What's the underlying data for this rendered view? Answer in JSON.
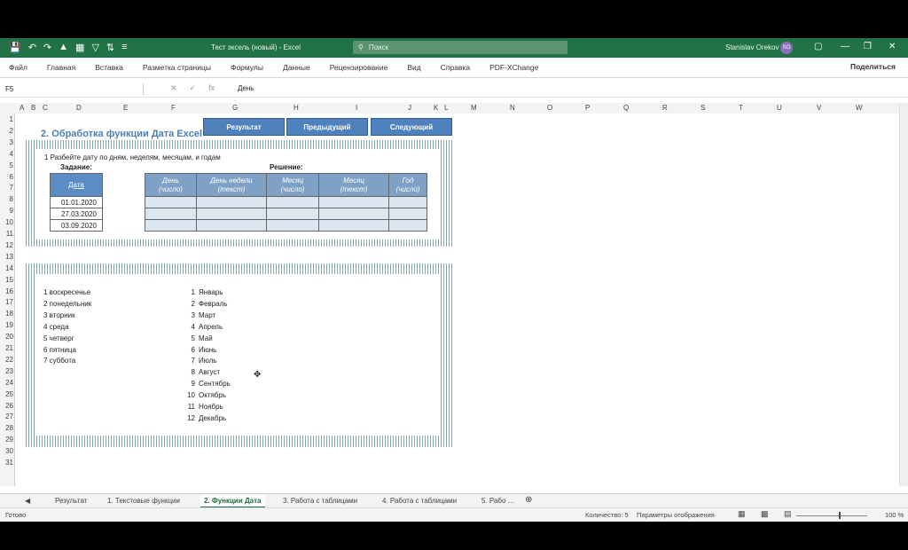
{
  "app": {
    "title": "Тест эксель (новый)  -  Excel",
    "search_placeholder": "Поиск",
    "user_name": "Stanislav Orekov",
    "user_initials": "SO"
  },
  "ribbon": {
    "tabs": [
      "Файл",
      "Главная",
      "Вставка",
      "Разметка страницы",
      "Формулы",
      "Данные",
      "Рецензирование",
      "Вид",
      "Справка",
      "PDF-XChange"
    ],
    "share_label": "Поделиться"
  },
  "formula_bar": {
    "name_box": "F5",
    "fx": "fx",
    "content": "День"
  },
  "columns": [
    "A",
    "B",
    "C",
    "D",
    "E",
    "F",
    "G",
    "H",
    "I",
    "J",
    "K",
    "L",
    "M",
    "N",
    "O",
    "P",
    "Q",
    "R",
    "S",
    "T",
    "U",
    "V",
    "W"
  ],
  "rows": [
    "1",
    "2",
    "3",
    "4",
    "5",
    "6",
    "7",
    "8",
    "9",
    "10",
    "11",
    "12",
    "13",
    "14",
    "15",
    "16",
    "17",
    "18",
    "19",
    "20",
    "21",
    "22",
    "23",
    "24",
    "25",
    "26",
    "27",
    "28",
    "29",
    "30",
    "31"
  ],
  "buttons": {
    "result": "Результат",
    "prev": "Предыдущий",
    "next": "Следующий"
  },
  "sheet": {
    "heading": "2. Обработка функции Дата Excel",
    "instruction": "1  Разбейте дату по дням, неделям, месяцам, и годам",
    "task_label": "Задание:",
    "solution_label": "Решение:",
    "task_header": "Дата",
    "dates": [
      "01.01.2020",
      "27.03.2020",
      "03.09.2020"
    ],
    "solution_headers": [
      [
        "День",
        "(число)"
      ],
      [
        "День недели",
        "(текст)"
      ],
      [
        "Месяц",
        "(число)"
      ],
      [
        "Месяц",
        "(текст)"
      ],
      [
        "Год",
        "(число)"
      ]
    ],
    "weekdays": [
      "1  воскресенье",
      "2  понедельник",
      "3  вторник",
      "4  среда",
      "5  четверг",
      "6  пятница",
      "7  суббота"
    ],
    "months": [
      {
        "n": "1",
        "name": "Январь"
      },
      {
        "n": "2",
        "name": "Февраль"
      },
      {
        "n": "3",
        "name": "Март"
      },
      {
        "n": "4",
        "name": "Апрель"
      },
      {
        "n": "5",
        "name": "Май"
      },
      {
        "n": "6",
        "name": "Июнь"
      },
      {
        "n": "7",
        "name": "Июль"
      },
      {
        "n": "8",
        "name": "Август"
      },
      {
        "n": "9",
        "name": "Сентябрь"
      },
      {
        "n": "10",
        "name": "Октябрь"
      },
      {
        "n": "11",
        "name": "Ноябрь"
      },
      {
        "n": "12",
        "name": "Декабрь"
      }
    ]
  },
  "sheet_tabs": [
    "Результат",
    "1. Текстовые функции",
    "2. Функции Дата",
    "3. Работа с таблицами",
    "4. Работа с таблицами",
    "5. Рабо ..."
  ],
  "active_sheet_tab": "2. Функции Дата",
  "status": {
    "ready": "Готово",
    "count": "Количество: 5",
    "accessibility": "Параметры отображения",
    "zoom": "100 %"
  },
  "colors": {
    "excel_green": "#217346",
    "button_blue": "#4f81bd",
    "header_blue": "#5b8dc4",
    "cell_blue": "#dbe6f1"
  }
}
